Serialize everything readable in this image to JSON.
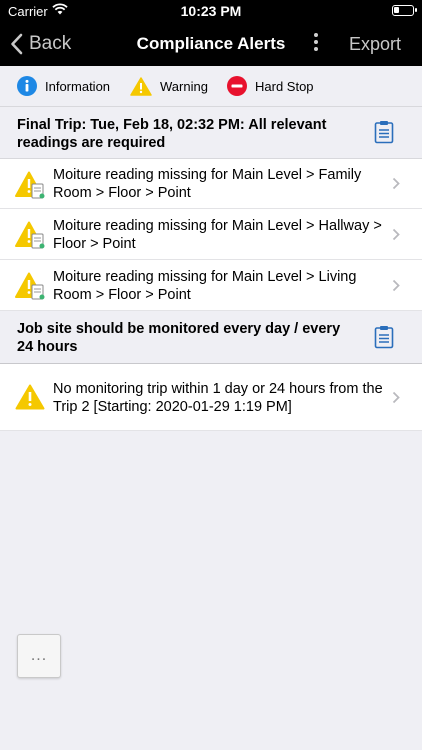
{
  "status_bar": {
    "carrier": "Carrier",
    "time": "10:23 PM"
  },
  "nav": {
    "back_label": "Back",
    "title": "Compliance Alerts",
    "export_label": "Export"
  },
  "legend": {
    "information_label": "Information",
    "warning_label": "Warning",
    "hard_stop_label": "Hard Stop"
  },
  "sections": [
    {
      "header": "Final Trip: Tue, Feb 18, 02:32 PM: All relevant readings are required",
      "rows": [
        {
          "text": "Moiture reading missing for Main Level > Family Room > Floor > Point"
        },
        {
          "text": "Moiture reading missing for Main Level > Hallway > Floor > Point"
        },
        {
          "text": "Moiture reading missing for Main Level > Living Room > Floor > Point"
        }
      ]
    },
    {
      "header": "Job site should be monitored every day / every 24 hours",
      "rows": [
        {
          "text": "No monitoring trip within 1 day or 24 hours from the Trip 2 [Starting: 2020-01-29 1:19 PM]"
        }
      ]
    }
  ],
  "float_button": {
    "label": "..."
  },
  "colors": {
    "info_blue": "#1e88e5",
    "warning_yellow": "#f5c800",
    "hard_stop_red": "#e8112d",
    "clipboard_blue": "#2a6ebb"
  }
}
